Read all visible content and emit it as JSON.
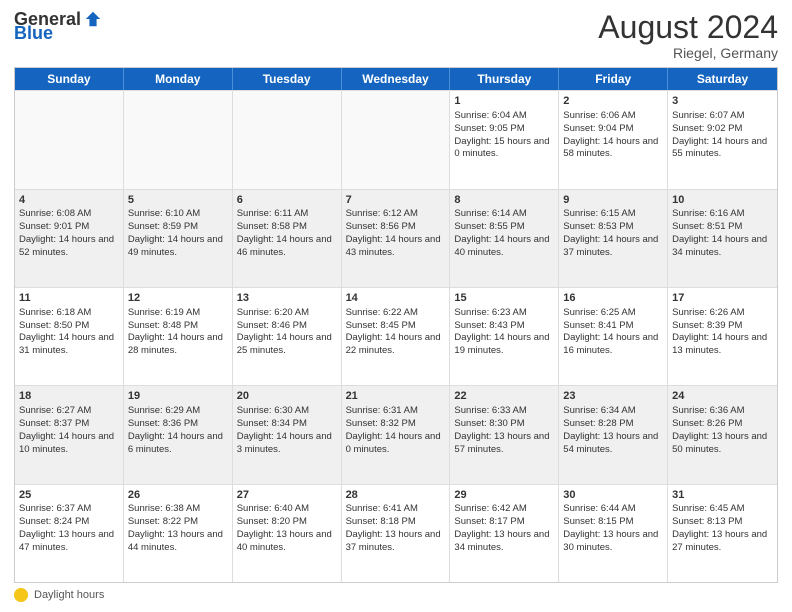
{
  "logo": {
    "general": "General",
    "blue": "Blue"
  },
  "title": {
    "month_year": "August 2024",
    "location": "Riegel, Germany"
  },
  "calendar": {
    "days_of_week": [
      "Sunday",
      "Monday",
      "Tuesday",
      "Wednesday",
      "Thursday",
      "Friday",
      "Saturday"
    ],
    "rows": [
      [
        {
          "day": "",
          "sunrise": "",
          "sunset": "",
          "daylight": "",
          "empty": true
        },
        {
          "day": "",
          "sunrise": "",
          "sunset": "",
          "daylight": "",
          "empty": true
        },
        {
          "day": "",
          "sunrise": "",
          "sunset": "",
          "daylight": "",
          "empty": true
        },
        {
          "day": "",
          "sunrise": "",
          "sunset": "",
          "daylight": "",
          "empty": true
        },
        {
          "day": "1",
          "sunrise": "Sunrise: 6:04 AM",
          "sunset": "Sunset: 9:05 PM",
          "daylight": "Daylight: 15 hours and 0 minutes.",
          "empty": false
        },
        {
          "day": "2",
          "sunrise": "Sunrise: 6:06 AM",
          "sunset": "Sunset: 9:04 PM",
          "daylight": "Daylight: 14 hours and 58 minutes.",
          "empty": false
        },
        {
          "day": "3",
          "sunrise": "Sunrise: 6:07 AM",
          "sunset": "Sunset: 9:02 PM",
          "daylight": "Daylight: 14 hours and 55 minutes.",
          "empty": false
        }
      ],
      [
        {
          "day": "4",
          "sunrise": "Sunrise: 6:08 AM",
          "sunset": "Sunset: 9:01 PM",
          "daylight": "Daylight: 14 hours and 52 minutes.",
          "empty": false
        },
        {
          "day": "5",
          "sunrise": "Sunrise: 6:10 AM",
          "sunset": "Sunset: 8:59 PM",
          "daylight": "Daylight: 14 hours and 49 minutes.",
          "empty": false
        },
        {
          "day": "6",
          "sunrise": "Sunrise: 6:11 AM",
          "sunset": "Sunset: 8:58 PM",
          "daylight": "Daylight: 14 hours and 46 minutes.",
          "empty": false
        },
        {
          "day": "7",
          "sunrise": "Sunrise: 6:12 AM",
          "sunset": "Sunset: 8:56 PM",
          "daylight": "Daylight: 14 hours and 43 minutes.",
          "empty": false
        },
        {
          "day": "8",
          "sunrise": "Sunrise: 6:14 AM",
          "sunset": "Sunset: 8:55 PM",
          "daylight": "Daylight: 14 hours and 40 minutes.",
          "empty": false
        },
        {
          "day": "9",
          "sunrise": "Sunrise: 6:15 AM",
          "sunset": "Sunset: 8:53 PM",
          "daylight": "Daylight: 14 hours and 37 minutes.",
          "empty": false
        },
        {
          "day": "10",
          "sunrise": "Sunrise: 6:16 AM",
          "sunset": "Sunset: 8:51 PM",
          "daylight": "Daylight: 14 hours and 34 minutes.",
          "empty": false
        }
      ],
      [
        {
          "day": "11",
          "sunrise": "Sunrise: 6:18 AM",
          "sunset": "Sunset: 8:50 PM",
          "daylight": "Daylight: 14 hours and 31 minutes.",
          "empty": false
        },
        {
          "day": "12",
          "sunrise": "Sunrise: 6:19 AM",
          "sunset": "Sunset: 8:48 PM",
          "daylight": "Daylight: 14 hours and 28 minutes.",
          "empty": false
        },
        {
          "day": "13",
          "sunrise": "Sunrise: 6:20 AM",
          "sunset": "Sunset: 8:46 PM",
          "daylight": "Daylight: 14 hours and 25 minutes.",
          "empty": false
        },
        {
          "day": "14",
          "sunrise": "Sunrise: 6:22 AM",
          "sunset": "Sunset: 8:45 PM",
          "daylight": "Daylight: 14 hours and 22 minutes.",
          "empty": false
        },
        {
          "day": "15",
          "sunrise": "Sunrise: 6:23 AM",
          "sunset": "Sunset: 8:43 PM",
          "daylight": "Daylight: 14 hours and 19 minutes.",
          "empty": false
        },
        {
          "day": "16",
          "sunrise": "Sunrise: 6:25 AM",
          "sunset": "Sunset: 8:41 PM",
          "daylight": "Daylight: 14 hours and 16 minutes.",
          "empty": false
        },
        {
          "day": "17",
          "sunrise": "Sunrise: 6:26 AM",
          "sunset": "Sunset: 8:39 PM",
          "daylight": "Daylight: 14 hours and 13 minutes.",
          "empty": false
        }
      ],
      [
        {
          "day": "18",
          "sunrise": "Sunrise: 6:27 AM",
          "sunset": "Sunset: 8:37 PM",
          "daylight": "Daylight: 14 hours and 10 minutes.",
          "empty": false
        },
        {
          "day": "19",
          "sunrise": "Sunrise: 6:29 AM",
          "sunset": "Sunset: 8:36 PM",
          "daylight": "Daylight: 14 hours and 6 minutes.",
          "empty": false
        },
        {
          "day": "20",
          "sunrise": "Sunrise: 6:30 AM",
          "sunset": "Sunset: 8:34 PM",
          "daylight": "Daylight: 14 hours and 3 minutes.",
          "empty": false
        },
        {
          "day": "21",
          "sunrise": "Sunrise: 6:31 AM",
          "sunset": "Sunset: 8:32 PM",
          "daylight": "Daylight: 14 hours and 0 minutes.",
          "empty": false
        },
        {
          "day": "22",
          "sunrise": "Sunrise: 6:33 AM",
          "sunset": "Sunset: 8:30 PM",
          "daylight": "Daylight: 13 hours and 57 minutes.",
          "empty": false
        },
        {
          "day": "23",
          "sunrise": "Sunrise: 6:34 AM",
          "sunset": "Sunset: 8:28 PM",
          "daylight": "Daylight: 13 hours and 54 minutes.",
          "empty": false
        },
        {
          "day": "24",
          "sunrise": "Sunrise: 6:36 AM",
          "sunset": "Sunset: 8:26 PM",
          "daylight": "Daylight: 13 hours and 50 minutes.",
          "empty": false
        }
      ],
      [
        {
          "day": "25",
          "sunrise": "Sunrise: 6:37 AM",
          "sunset": "Sunset: 8:24 PM",
          "daylight": "Daylight: 13 hours and 47 minutes.",
          "empty": false
        },
        {
          "day": "26",
          "sunrise": "Sunrise: 6:38 AM",
          "sunset": "Sunset: 8:22 PM",
          "daylight": "Daylight: 13 hours and 44 minutes.",
          "empty": false
        },
        {
          "day": "27",
          "sunrise": "Sunrise: 6:40 AM",
          "sunset": "Sunset: 8:20 PM",
          "daylight": "Daylight: 13 hours and 40 minutes.",
          "empty": false
        },
        {
          "day": "28",
          "sunrise": "Sunrise: 6:41 AM",
          "sunset": "Sunset: 8:18 PM",
          "daylight": "Daylight: 13 hours and 37 minutes.",
          "empty": false
        },
        {
          "day": "29",
          "sunrise": "Sunrise: 6:42 AM",
          "sunset": "Sunset: 8:17 PM",
          "daylight": "Daylight: 13 hours and 34 minutes.",
          "empty": false
        },
        {
          "day": "30",
          "sunrise": "Sunrise: 6:44 AM",
          "sunset": "Sunset: 8:15 PM",
          "daylight": "Daylight: 13 hours and 30 minutes.",
          "empty": false
        },
        {
          "day": "31",
          "sunrise": "Sunrise: 6:45 AM",
          "sunset": "Sunset: 8:13 PM",
          "daylight": "Daylight: 13 hours and 27 minutes.",
          "empty": false
        }
      ]
    ]
  },
  "footer": {
    "legend_label": "Daylight hours"
  }
}
